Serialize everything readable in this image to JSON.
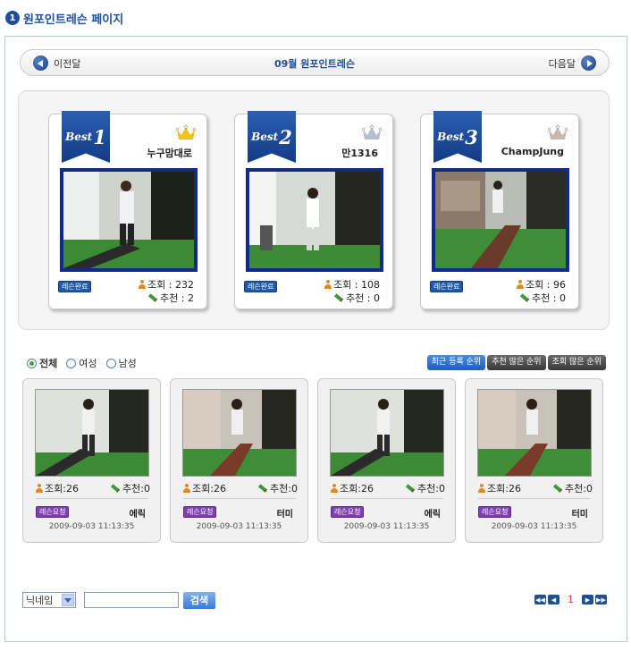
{
  "page": {
    "title_num": "1",
    "title": "원포인트레슨 페이지"
  },
  "month_nav": {
    "prev_label": "이전달",
    "title": "09월 원포인트레슨",
    "next_label": "다음달"
  },
  "best": [
    {
      "rank_word": "Best",
      "rank": "1",
      "name": "누구맘대로",
      "badge": "레슨완료",
      "views": "조회 : 232",
      "recs": "추천 : 2",
      "crown_color": "#f2c21b"
    },
    {
      "rank_word": "Best",
      "rank": "2",
      "name": "만1316",
      "badge": "레슨완료",
      "views": "조회 : 108",
      "recs": "추천 : 0",
      "crown_color": "#b9bfd0"
    },
    {
      "rank_word": "Best",
      "rank": "3",
      "name": "ChampJung",
      "badge": "레슨완료",
      "views": "조회 : 96",
      "recs": "추천 : 0",
      "crown_color": "#c9b7b2"
    }
  ],
  "filters": {
    "all": "전체",
    "female": "여성",
    "male": "남성"
  },
  "sort": {
    "recent": "최근 등록 순위",
    "most_recommended": "추천 많은 순위",
    "most_viewed": "조회 많은 순위"
  },
  "list": [
    {
      "views": "조회:26",
      "recs": "추천:0",
      "badge": "레슨요청",
      "user": "에릭",
      "date": "2009-09-03 11:13:35"
    },
    {
      "views": "조회:26",
      "recs": "추천:0",
      "badge": "레슨요청",
      "user": "터미",
      "date": "2009-09-03 11:13:35"
    },
    {
      "views": "조회:26",
      "recs": "추천:0",
      "badge": "레슨요청",
      "user": "에릭",
      "date": "2009-09-03 11:13:35"
    },
    {
      "views": "조회:26",
      "recs": "추천:0",
      "badge": "레슨요청",
      "user": "터미",
      "date": "2009-09-03 11:13:35"
    }
  ],
  "search": {
    "field": "닉네임",
    "query": "",
    "button": "검색"
  },
  "pager": {
    "current": "1"
  },
  "colors": {
    "brand": "#1f4f9c",
    "done_badge": "#1f5ba8",
    "request_badge": "#7e3fb0"
  }
}
